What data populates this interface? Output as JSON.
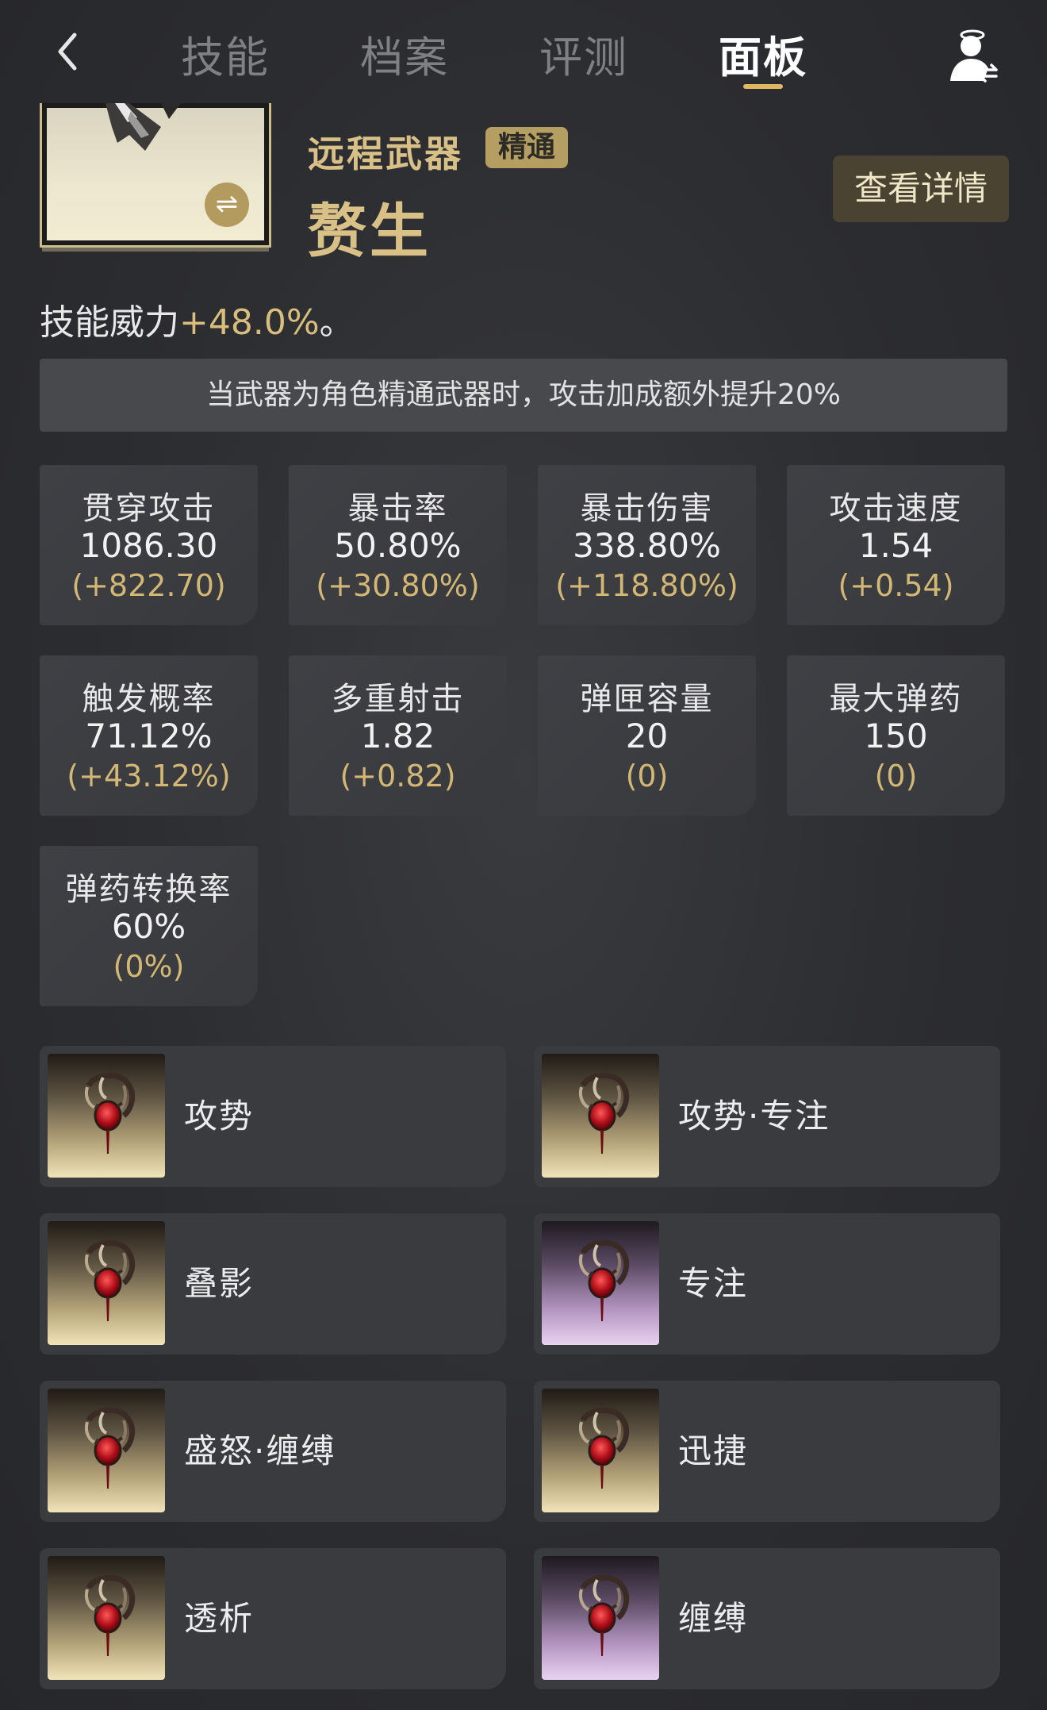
{
  "header": {
    "tabs": [
      {
        "label": "技能"
      },
      {
        "label": "档案"
      },
      {
        "label": "评测"
      },
      {
        "label": "面板"
      }
    ],
    "active_tab": "面板"
  },
  "weapon": {
    "type": "远程武器",
    "badge": "精通",
    "name": "赘生",
    "details_label": "查看详情"
  },
  "skill_power": {
    "prefix": "技能威力",
    "value": "+48.0%",
    "suffix": "。"
  },
  "notice": "当武器为角色精通武器时，攻击加成额外提升20%",
  "stats": [
    {
      "label": "贯穿攻击",
      "value": "1086.30",
      "bonus": "(+822.70)"
    },
    {
      "label": "暴击率",
      "value": "50.80%",
      "bonus": "(+30.80%)"
    },
    {
      "label": "暴击伤害",
      "value": "338.80%",
      "bonus": "(+118.80%)"
    },
    {
      "label": "攻击速度",
      "value": "1.54",
      "bonus": "(+0.54)"
    },
    {
      "label": "触发概率",
      "value": "71.12%",
      "bonus": "(+43.12%)"
    },
    {
      "label": "多重射击",
      "value": "1.82",
      "bonus": "(+0.82)"
    },
    {
      "label": "弹匣容量",
      "value": "20",
      "bonus": "(0)"
    },
    {
      "label": "最大弹药",
      "value": "150",
      "bonus": "(0)"
    },
    {
      "label": "弹药转换率",
      "value": "60%",
      "bonus": "(0%)"
    }
  ],
  "skills": [
    {
      "name": "攻势",
      "icon": "mod-gem-icon",
      "tier": "gold"
    },
    {
      "name": "攻势·专注",
      "icon": "mod-gem-icon",
      "tier": "gold"
    },
    {
      "name": "叠影",
      "icon": "mod-gem-icon",
      "tier": "gold"
    },
    {
      "name": "专注",
      "icon": "mod-gem-icon",
      "tier": "purple"
    },
    {
      "name": "盛怒·缠缚",
      "icon": "mod-gem-icon",
      "tier": "gold"
    },
    {
      "name": "迅捷",
      "icon": "mod-gem-icon",
      "tier": "gold"
    },
    {
      "name": "透析",
      "icon": "mod-gem-icon",
      "tier": "gold"
    },
    {
      "name": "缠缚",
      "icon": "mod-gem-icon",
      "tier": "purple"
    }
  ],
  "colors": {
    "accent_gold": "#d9c087",
    "tab_underline": "#e0b864",
    "badge_bg": "#b59e62",
    "details_bg": "#4a4331"
  }
}
